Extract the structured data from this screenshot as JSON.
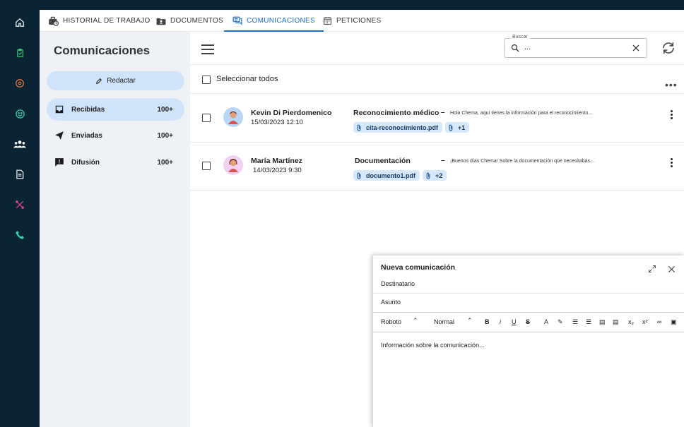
{
  "tabs": [
    {
      "label": "HISTORIAL DE TRABAJO",
      "icon": "briefcase-clock-icon"
    },
    {
      "label": "DOCUMENTOS",
      "icon": "folder-person-icon"
    },
    {
      "label": "COMUNICACIONES",
      "icon": "chat-icon",
      "active": true
    },
    {
      "label": "PETICIONES",
      "icon": "calendar-icon"
    }
  ],
  "nav": [
    {
      "icon": "home-icon",
      "color": "#ffffff"
    },
    {
      "icon": "clipboard-check-icon",
      "color": "#39d17a"
    },
    {
      "icon": "location-pin-icon",
      "color": "#e8793a"
    },
    {
      "icon": "smiley-icon",
      "color": "#2ed1b8"
    },
    {
      "icon": "group-icon",
      "color": "#ffffff"
    },
    {
      "icon": "document-icon",
      "color": "#ffffff"
    },
    {
      "icon": "tools-icon",
      "color": "#e0449b"
    },
    {
      "icon": "phone-icon",
      "color": "#2ed1b8"
    }
  ],
  "sidebar": {
    "title": "Comunicaciones",
    "compose_label": "Redactar",
    "folders": [
      {
        "label": "Recibidas",
        "count": "100+",
        "icon": "inbox-icon"
      },
      {
        "label": "Enviadas",
        "count": "100+",
        "icon": "send-icon"
      },
      {
        "label": "Difusión",
        "count": "100+",
        "icon": "announcement-icon"
      }
    ]
  },
  "toolbar": {
    "search_label": "Buscar",
    "search_value": "..."
  },
  "list": {
    "select_all_label": "Seleccionar todos",
    "messages": [
      {
        "sender": "Kevin Di Pierdomenico",
        "date": "15/03/2023 12:10",
        "subject": "Reconocimiento médico",
        "preview": "Hola Chema, aquí tienes la información para el reconocimiento...",
        "attachment": "cita-reconocimiento.pdf",
        "extra": "+1",
        "avatar_bg": "#b9d6f5"
      },
      {
        "sender": "María Martínez",
        "date": "14/03/2023 9:30",
        "subject": "Documentación",
        "preview": "¡Buenos días Chema! Sobre la documentación que necesitabas...",
        "attachment": "documento1.pdf",
        "extra": "+2",
        "avatar_bg": "#f1d0f0"
      }
    ]
  },
  "compose": {
    "title": "Nueva comunicación",
    "recipient_placeholder": "Destinatario",
    "subject_placeholder": "Asunto",
    "font": "Roboto",
    "size": "Normal",
    "body_placeholder": "Información sobre la comunicación..."
  },
  "colors": {
    "accent": "#1a6fc9",
    "nav_bg": "#0b2433",
    "chip_bg": "#d6e8fb",
    "sidebar_active": "#cfe3fb"
  }
}
